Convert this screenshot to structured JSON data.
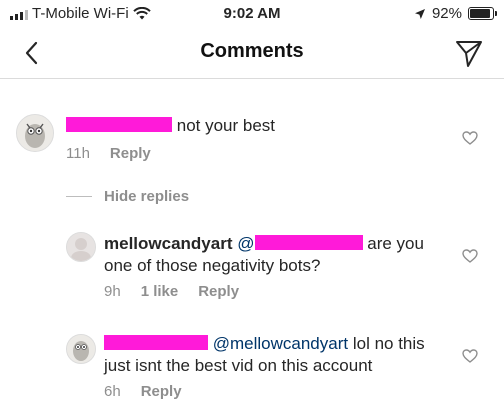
{
  "status_bar": {
    "carrier": "T-Mobile Wi-Fi",
    "time": "9:02 AM",
    "battery": "92%",
    "battery_level": 0.92
  },
  "nav": {
    "title": "Comments",
    "back_icon": "chevron-left-icon",
    "send_icon": "paper-plane-icon"
  },
  "comments": [
    {
      "text": "not your best",
      "time": "11h",
      "reply_label": "Reply"
    }
  ],
  "hide_replies_label": "Hide replies",
  "replies": [
    {
      "username": "mellowcandyart",
      "text_line1": "are you",
      "text_line2": "one of those negativity bots?",
      "time": "9h",
      "likes": "1 like",
      "reply_label": "Reply"
    },
    {
      "mention": "@mellowcandyart",
      "text_line1": "lol no this",
      "text_line2": "just isnt the best vid on this account",
      "time": "6h",
      "reply_label": "Reply"
    }
  ]
}
